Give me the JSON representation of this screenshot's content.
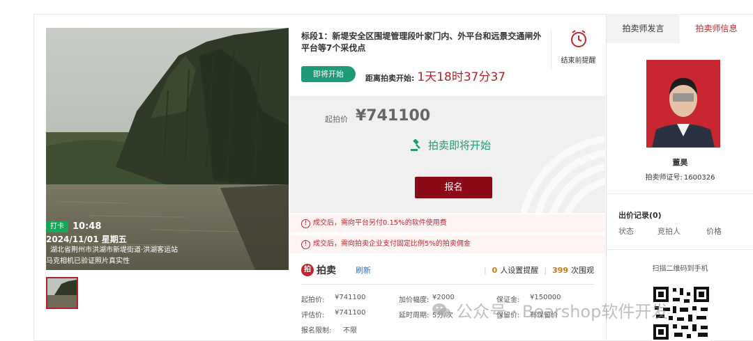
{
  "listing": {
    "title": "标段1：新堤安全区围堤管理段叶家门内、外平台和远景交通闸外平台等7个采伐点",
    "status": "即将开始",
    "countdown_label": "距离拍卖开始:",
    "countdown": "1天18时37分37",
    "remind_label": "结束前提醒"
  },
  "photo": {
    "badge": "打卡",
    "time": "10:48",
    "date": "2024/11/01 星期五",
    "location": "湖北省荆州市洪湖市新堤街道·洪湖客运站",
    "verify": "马克相机已验证照片真实性"
  },
  "price": {
    "start_label": "起拍价",
    "start_price": "¥741100",
    "coming_text": "拍卖即将开始",
    "signup_label": "报名"
  },
  "notices": [
    "成交后，需向平台另付0.15%的软件使用费",
    "成交后，需向拍卖企业支付固定比例5%的拍卖佣金"
  ],
  "meta": {
    "brand": "拍卖",
    "refresh": "刷新",
    "reminders_count": "0",
    "reminders_label": "人设置提醒",
    "views_count": "399",
    "views_label": "次围观"
  },
  "details": {
    "row1": [
      {
        "k": "起拍价:",
        "v": "¥741100"
      },
      {
        "k": "加价幅度:",
        "v": "¥2000"
      },
      {
        "k": "保证金:",
        "v": "¥150000"
      }
    ],
    "row2": [
      {
        "k": "评估价:",
        "v": "¥741100"
      },
      {
        "k": "延时周期:",
        "v": "5分/次"
      },
      {
        "k": "保留价:",
        "v": "有保留价"
      }
    ],
    "row3": [
      {
        "k": "报名限制:",
        "v": "不限"
      }
    ]
  },
  "auctioneer": {
    "tab1": "拍卖师发言",
    "tab2": "拍卖师信息",
    "name": "董昊",
    "cert_label": "拍卖师证号:",
    "cert_no": "1600326"
  },
  "bids": {
    "title": "出价记录(0)",
    "cols": [
      "状态",
      "竞拍人",
      "价格"
    ]
  },
  "qr": {
    "label": "扫描二维码到手机"
  },
  "watermark": {
    "text": "公众号 · Bearshop软件开发"
  },
  "colors": {
    "accent_red": "#8b0a17",
    "status_green": "#1e9a78",
    "link_blue": "#2c6fd1"
  }
}
